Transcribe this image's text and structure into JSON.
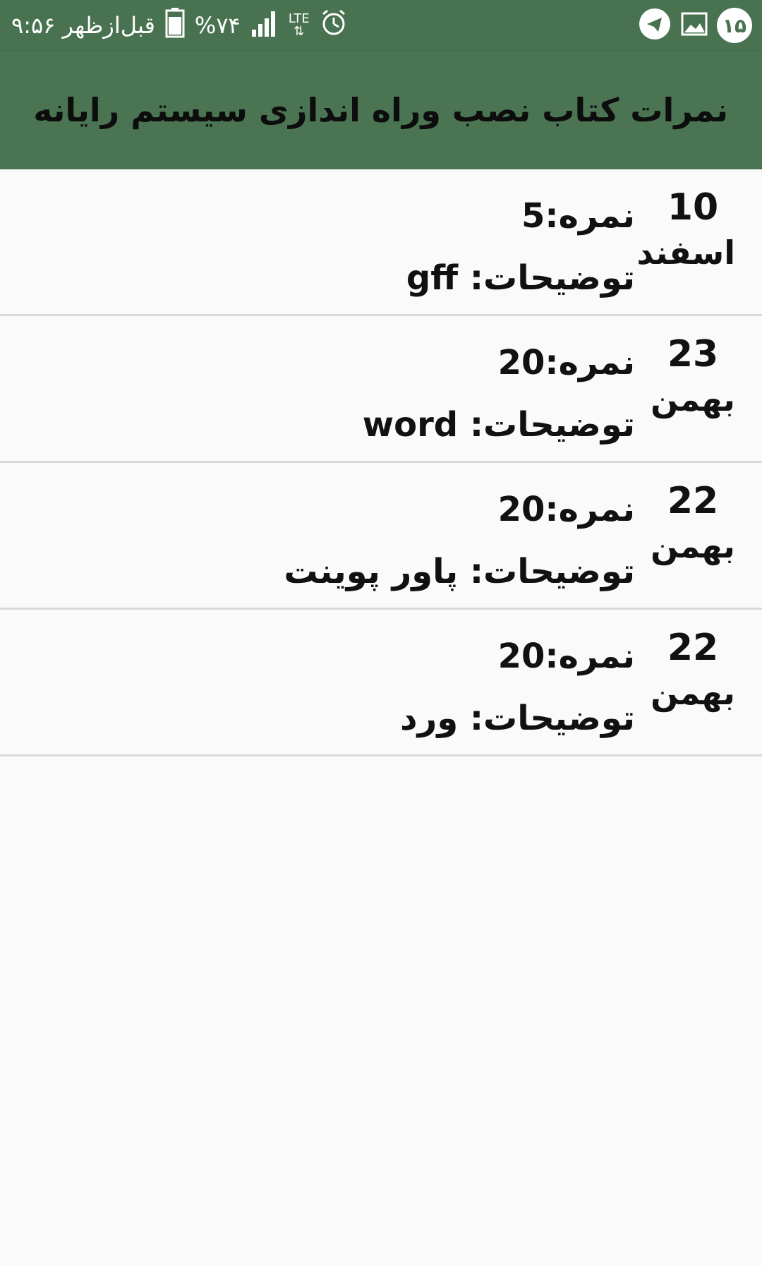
{
  "status_bar": {
    "time": "۹:۵۶ قبل‌ازظهر",
    "battery_percent": "%۷۴",
    "network_type": "LTE",
    "notification_count": "۱۵",
    "icons": [
      "alarm-icon",
      "signal-icon",
      "battery-icon",
      "gallery-icon",
      "telegram-icon"
    ]
  },
  "app_bar": {
    "title": "نمرات کتاب نصب وراه اندازی سیستم رایانه"
  },
  "grades": [
    {
      "day": "10",
      "month": "اسفند",
      "score": "نمره:5",
      "description": "توضیحات: gff"
    },
    {
      "day": "23",
      "month": "بهمن",
      "score": "نمره:20",
      "description": "توضیحات: word"
    },
    {
      "day": "22",
      "month": "بهمن",
      "score": "نمره:20",
      "description": "توضیحات: پاور پوینت"
    },
    {
      "day": "22",
      "month": "بهمن",
      "score": "نمره:20",
      "description": "توضیحات: ورد"
    }
  ],
  "colors": {
    "status_bar": "#487250",
    "app_bar": "#4a7452",
    "background": "#fafafa",
    "divider": "#d9d9d9"
  }
}
